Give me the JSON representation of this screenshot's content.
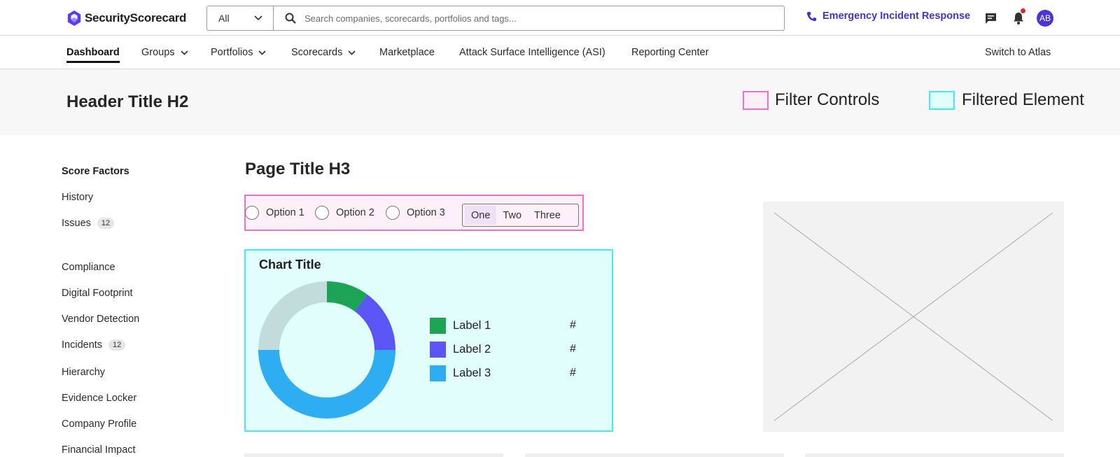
{
  "brand": {
    "name": "SecurityScorecard",
    "accent": "#4a2fd0"
  },
  "search": {
    "scope": "All",
    "placeholder": "Search companies, scorecards, portfolios and tags..."
  },
  "top_actions": {
    "emergency": "Emergency Incident Response",
    "avatar_initials": "AB",
    "notification_dot_color": "#d7262f"
  },
  "nav": {
    "items": [
      {
        "label": "Dashboard",
        "active": true,
        "dropdown": false
      },
      {
        "label": "Groups",
        "dropdown": true
      },
      {
        "label": "Portfolios",
        "dropdown": true
      },
      {
        "label": "Scorecards",
        "dropdown": true
      },
      {
        "label": "Marketplace",
        "dropdown": false
      },
      {
        "label": "Attack Surface Intelligence (ASI)",
        "dropdown": false
      },
      {
        "label": "Reporting Center",
        "dropdown": false
      }
    ],
    "switch_label": "Switch to Atlas"
  },
  "header": {
    "title": "Header Title H2",
    "legend": [
      {
        "label": "Filter Controls",
        "color": "#f171c8",
        "fill": "#fdeff8"
      },
      {
        "label": "Filtered Element",
        "color": "#41ebf0",
        "fill": "#e1fdfc"
      }
    ]
  },
  "sidebar": {
    "items": [
      {
        "label": "Score Factors",
        "bold": true
      },
      {
        "label": "History"
      },
      {
        "label": "Issues",
        "count": "12"
      },
      {
        "label": "Compliance"
      },
      {
        "label": "Digital Footprint"
      },
      {
        "label": "Vendor Detection"
      },
      {
        "label": "Incidents",
        "count": "12"
      },
      {
        "label": "Hierarchy"
      },
      {
        "label": "Evidence Locker"
      },
      {
        "label": "Company Profile"
      },
      {
        "label": "Financial Impact"
      }
    ]
  },
  "main": {
    "title": "Page Title H3",
    "filters": {
      "radios": [
        "Option 1",
        "Option 2",
        "Option 3"
      ],
      "segments": [
        "One",
        "Two",
        "Three"
      ],
      "selected_segment": "One"
    }
  },
  "chart_data": {
    "type": "pie",
    "title": "Chart Title",
    "donut": true,
    "categories": [
      "Label 1",
      "Label 2",
      "Label 3"
    ],
    "values": [
      10,
      15,
      50
    ],
    "value_labels": [
      "#",
      "#",
      "#"
    ],
    "colors": [
      "#1da354",
      "#5c55f5",
      "#2fadf2"
    ],
    "remainder": {
      "value": 25,
      "color": "#c2dcdc"
    },
    "legend": "right"
  }
}
